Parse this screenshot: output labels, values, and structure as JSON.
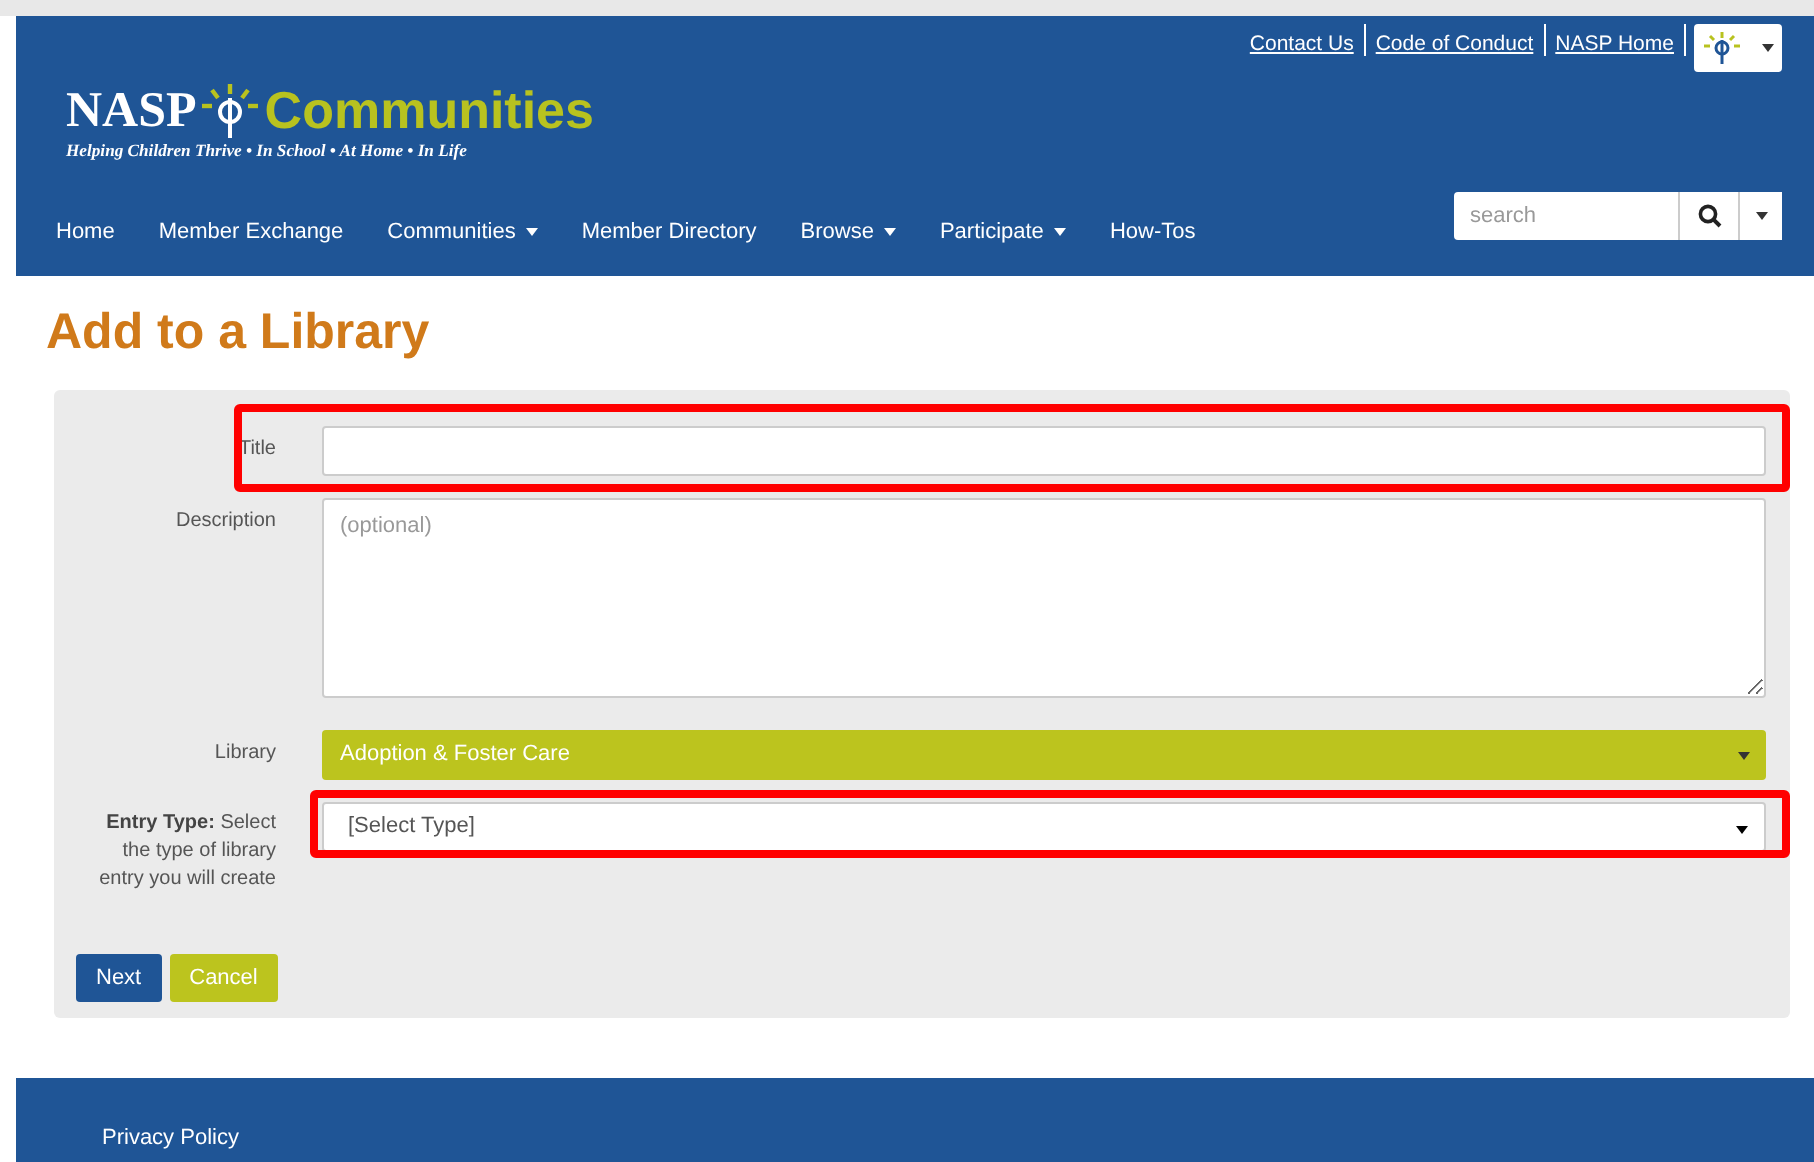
{
  "header": {
    "top_links": [
      "Contact Us",
      "Code of Conduct",
      "NASP Home"
    ],
    "logo": {
      "word": "NASP",
      "name": "Communities",
      "tagline": "Helping Children Thrive  •  In School  •  At Home  •  In Life"
    },
    "nav": [
      {
        "label": "Home",
        "has_menu": false
      },
      {
        "label": "Member Exchange",
        "has_menu": false
      },
      {
        "label": "Communities",
        "has_menu": true
      },
      {
        "label": "Member Directory",
        "has_menu": false
      },
      {
        "label": "Browse",
        "has_menu": true
      },
      {
        "label": "Participate",
        "has_menu": true
      },
      {
        "label": "How-Tos",
        "has_menu": false
      }
    ],
    "search": {
      "placeholder": "search"
    }
  },
  "page_title": "Add to a Library",
  "form": {
    "fields": [
      {
        "kind": "text",
        "label": "Title",
        "highlighted": true
      },
      {
        "kind": "textarea",
        "label": "Description",
        "placeholder": "(optional)",
        "highlighted": false
      },
      {
        "kind": "library",
        "label": "Library",
        "value": "Adoption & Foster Care",
        "highlighted": false
      },
      {
        "kind": "select",
        "label": "**Entry Type:** Select the type of library entry you will create",
        "value": "[Select Type]",
        "highlighted": true
      }
    ],
    "buttons": [
      {
        "label": "Next",
        "kind": "primary"
      },
      {
        "label": "Cancel",
        "kind": "secondary"
      }
    ]
  },
  "footer": {
    "links": [
      "Privacy Policy"
    ]
  }
}
